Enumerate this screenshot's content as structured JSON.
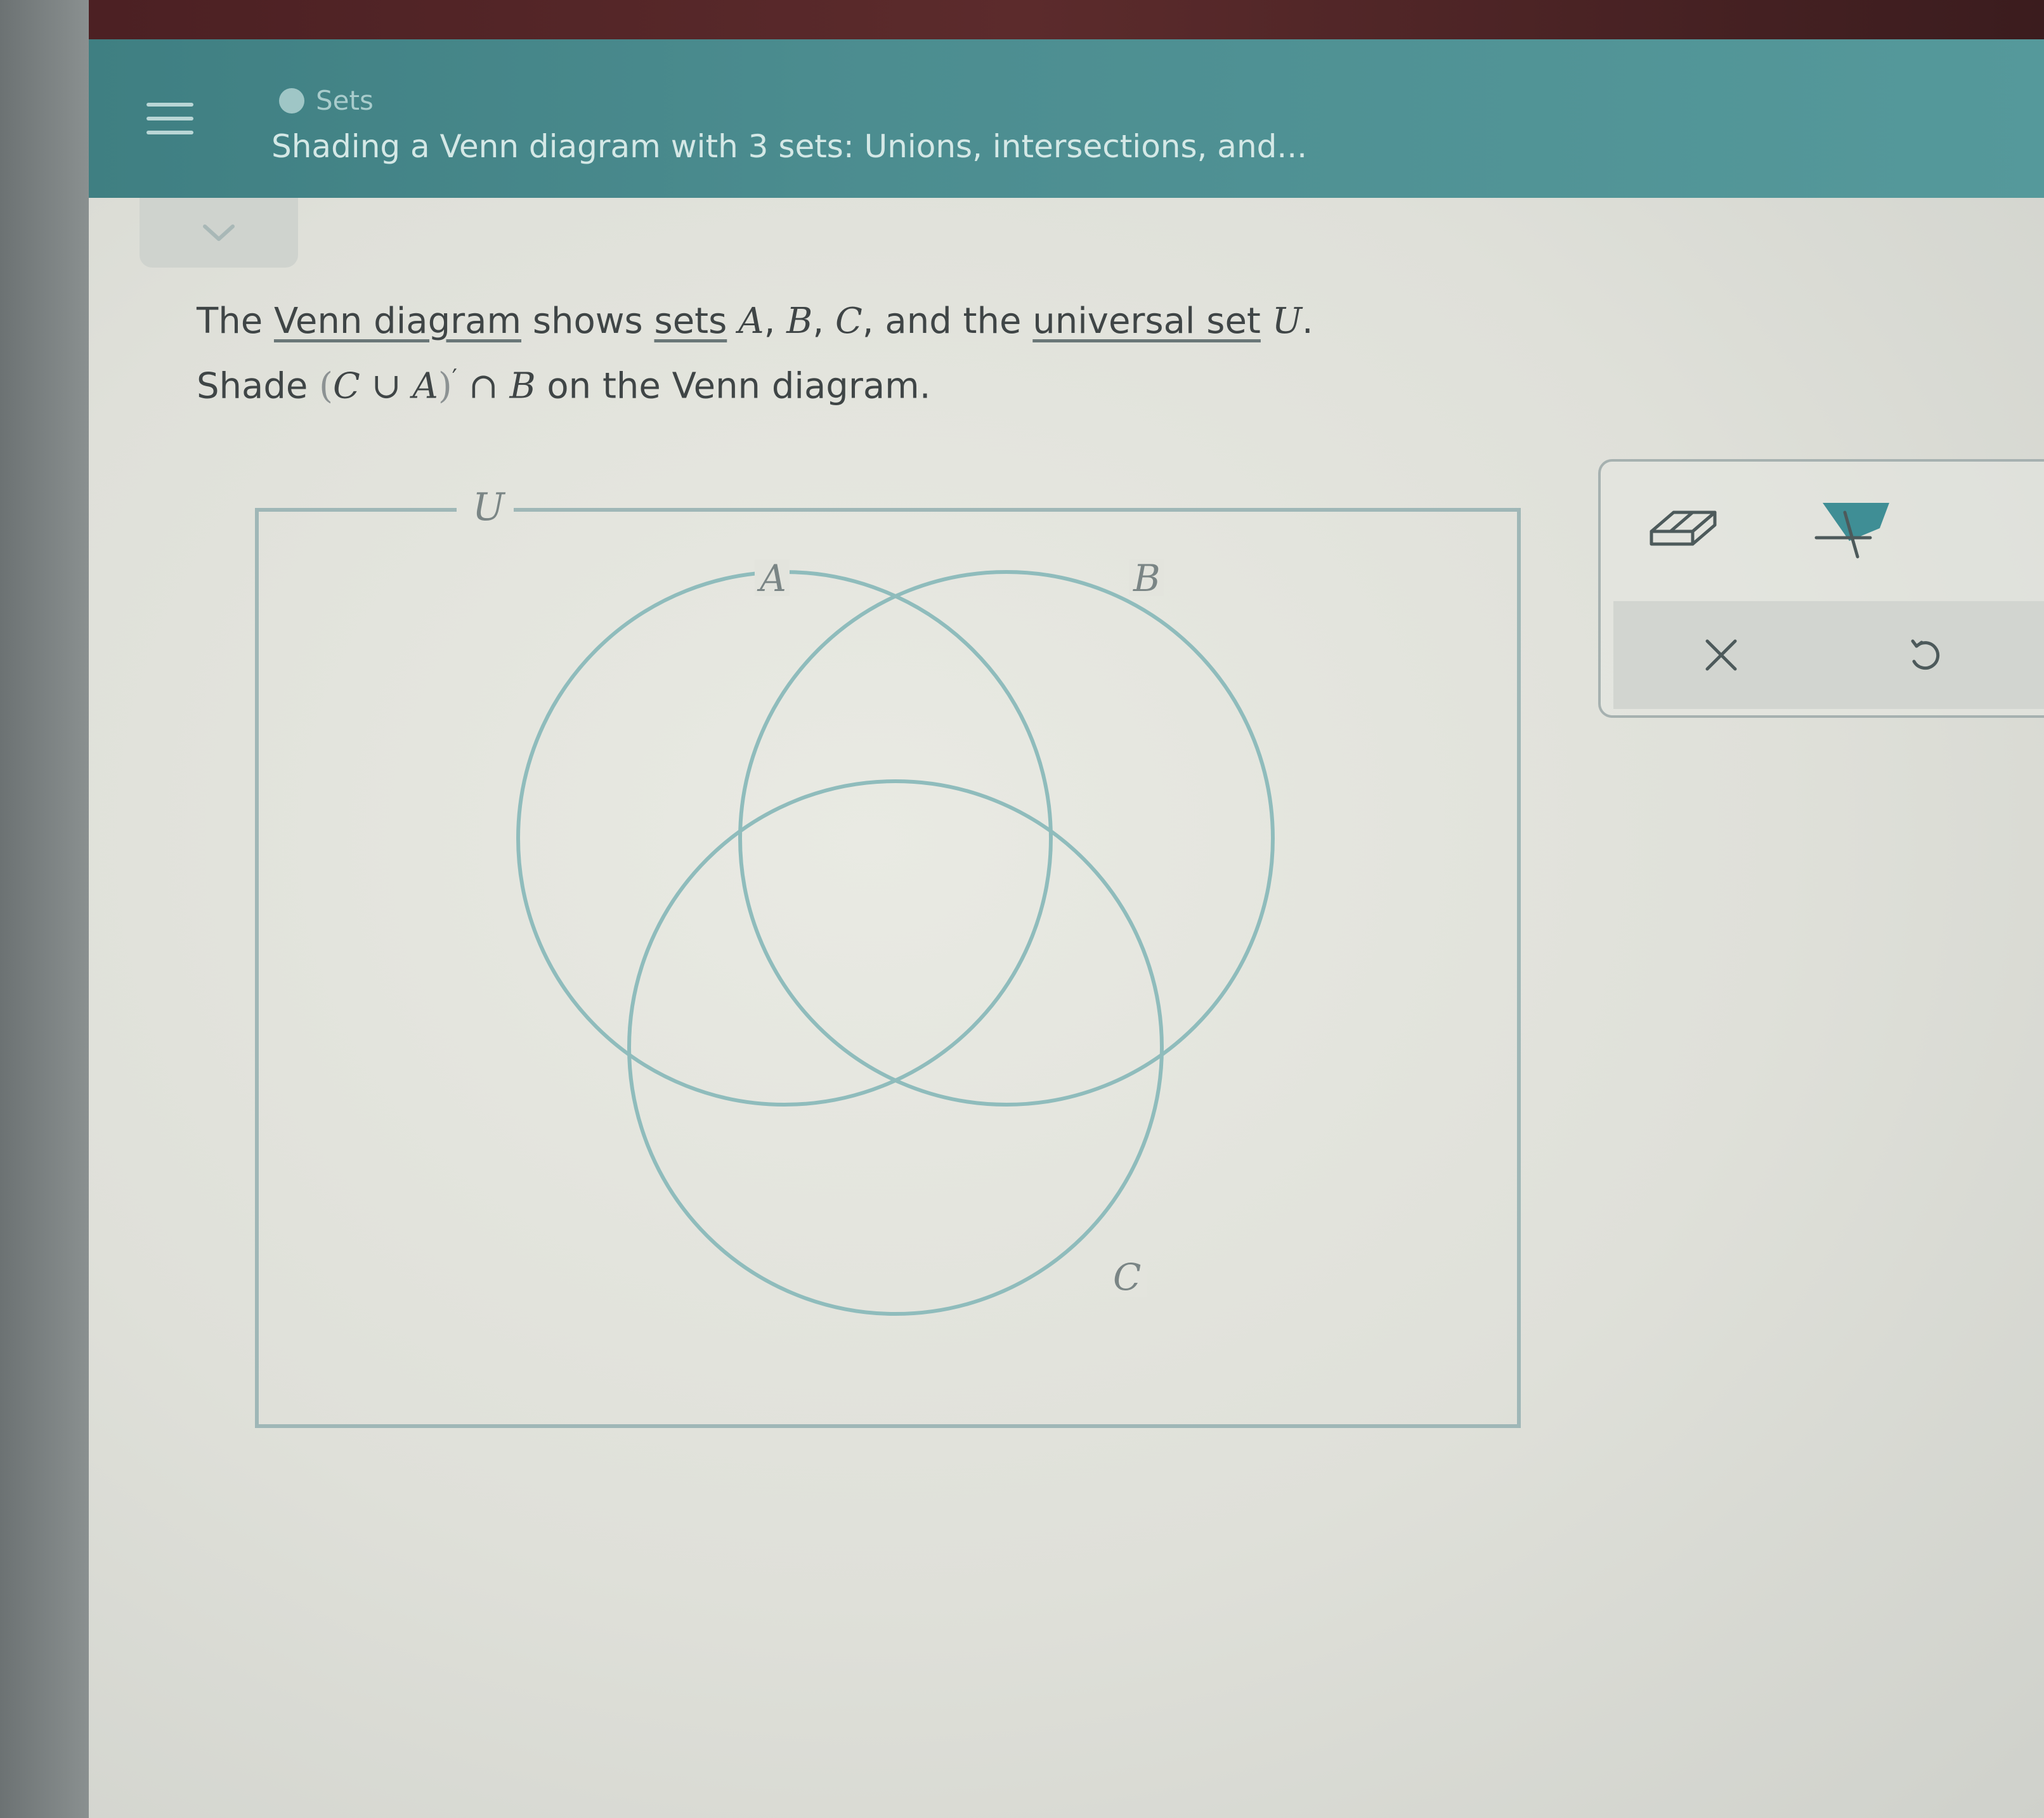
{
  "header": {
    "topic": "Sets",
    "lesson_title": "Shading a Venn diagram with 3 sets: Unions, intersections, and..."
  },
  "question": {
    "line1": {
      "t1": "The ",
      "link_venn": "Venn diagram",
      "t2": " shows ",
      "link_sets": "sets",
      "t3": " ",
      "A": "A",
      "c1": ", ",
      "B": "B",
      "c2": ", ",
      "C": "C",
      "t4": ", and the ",
      "link_universal": "universal set",
      "t5": " ",
      "U": "U",
      "t6": "."
    },
    "line2": {
      "t1": "Shade ",
      "open": "(",
      "C": "C",
      "union": " ∪ ",
      "A": "A",
      "close": ")",
      "prime": "′",
      "inter": " ∩ ",
      "B": "B",
      "t2": " on the Venn diagram."
    }
  },
  "venn": {
    "universal_label": "U",
    "set_labels": {
      "A": "A",
      "B": "B",
      "C": "C"
    },
    "stroke_color": "#8fbcbc",
    "frame_color": "#9fb7b7"
  },
  "tools": {
    "eraser_icon": "eraser-icon",
    "fill_icon": "fill-shade-icon",
    "clear_symbol": "×",
    "undo_icon": "undo-icon",
    "accent": "#3f8e95"
  }
}
